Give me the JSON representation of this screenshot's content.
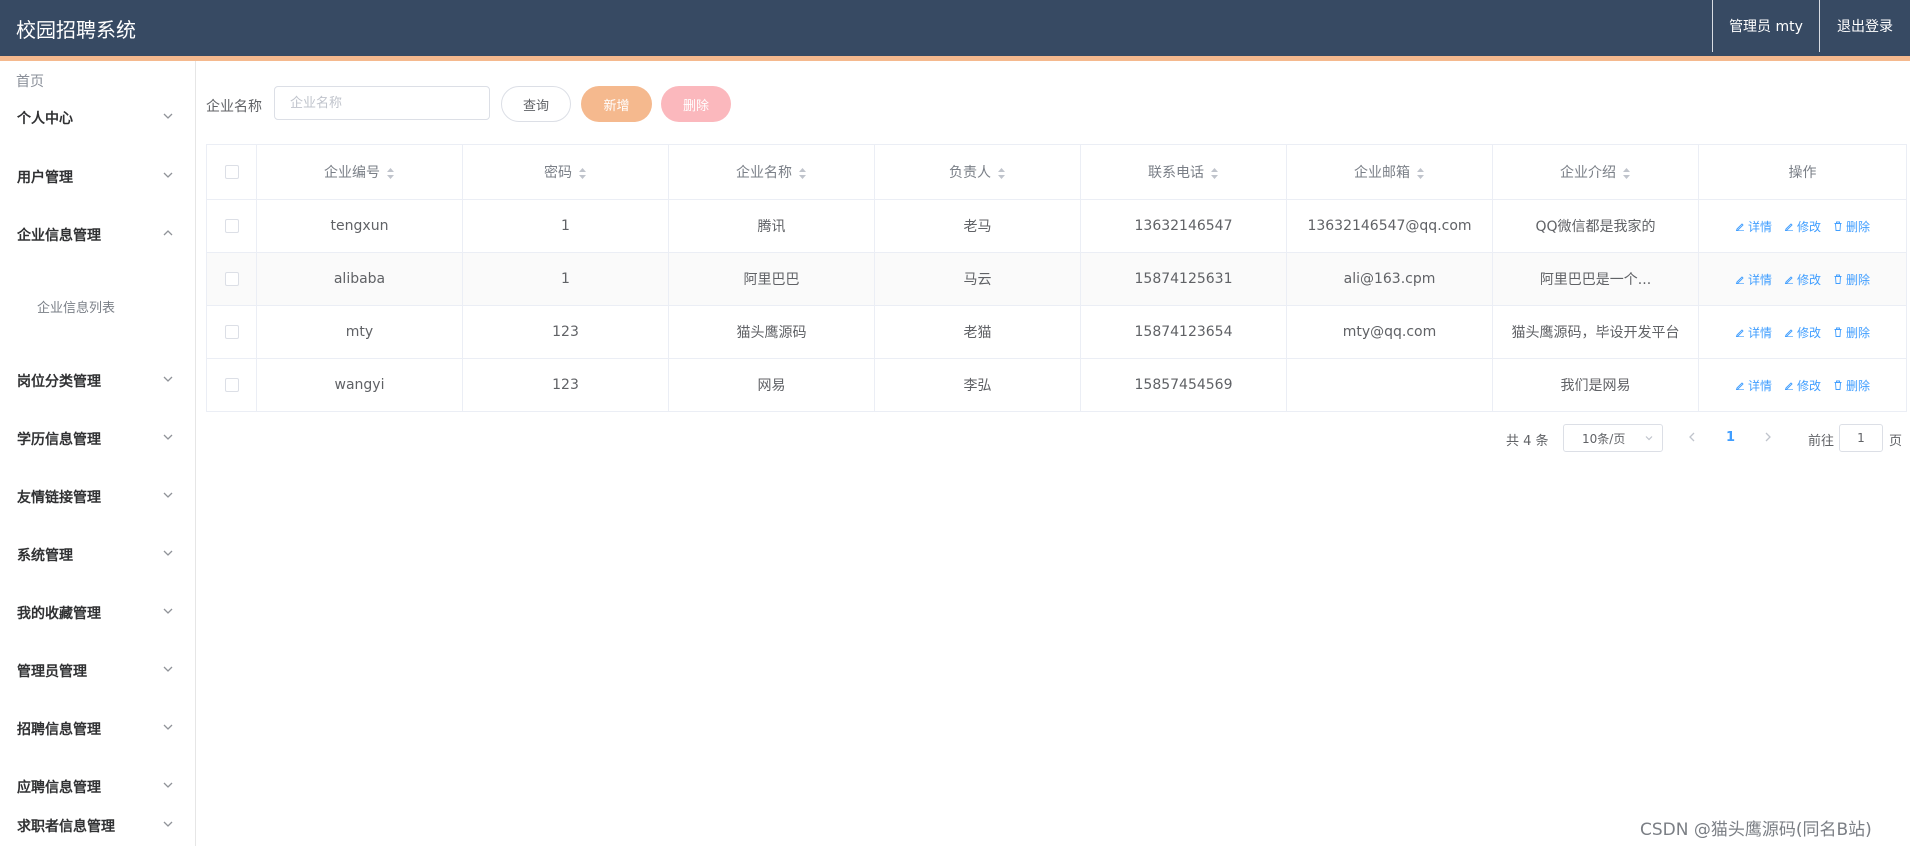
{
  "header": {
    "title": "校园招聘系统",
    "user": "管理员 mty",
    "logout": "退出登录"
  },
  "sidebar": {
    "home": "首页",
    "items": [
      {
        "label": "个人中心",
        "expanded": false
      },
      {
        "label": "用户管理",
        "expanded": false
      },
      {
        "label": "企业信息管理",
        "expanded": true,
        "sub": "企业信息列表"
      },
      {
        "label": "岗位分类管理",
        "expanded": false
      },
      {
        "label": "学历信息管理",
        "expanded": false
      },
      {
        "label": "友情链接管理",
        "expanded": false
      },
      {
        "label": "系统管理",
        "expanded": false
      },
      {
        "label": "我的收藏管理",
        "expanded": false
      },
      {
        "label": "管理员管理",
        "expanded": false
      },
      {
        "label": "招聘信息管理",
        "expanded": false
      },
      {
        "label": "应聘信息管理",
        "expanded": false
      },
      {
        "label": "求职者信息管理",
        "expanded": false
      }
    ]
  },
  "search": {
    "label": "企业名称",
    "placeholder": "企业名称",
    "query": "查询",
    "add": "新增",
    "delete": "删除"
  },
  "table": {
    "columns": [
      "企业编号",
      "密码",
      "企业名称",
      "负责人",
      "联系电话",
      "企业邮箱",
      "企业介绍",
      "操作"
    ],
    "actions": {
      "detail": "详情",
      "edit": "修改",
      "delete": "删除"
    },
    "rows": [
      [
        "tengxun",
        "1",
        "腾讯",
        "老马",
        "13632146547",
        "13632146547@qq.com",
        "QQ微信都是我家的"
      ],
      [
        "alibaba",
        "1",
        "阿里巴巴",
        "马云",
        "15874125631",
        "ali@163.cpm",
        "阿里巴巴是一个..."
      ],
      [
        "mty",
        "123",
        "猫头鹰源码",
        "老猫",
        "15874123654",
        "mty@qq.com",
        "猫头鹰源码，毕设开发平台"
      ],
      [
        "wangyi",
        "123",
        "网易",
        "李弘",
        "15857454569",
        "",
        "我们是网易"
      ]
    ]
  },
  "pagination": {
    "total": "共 4 条",
    "page_size": "10条/页",
    "current": "1",
    "goto_prefix": "前往",
    "goto_value": "1",
    "goto_suffix": "页"
  },
  "watermark": "CSDN @猫头鹰源码(同名B站)",
  "colors": {
    "header": "#374a63",
    "accent": "#f5b98e",
    "delete": "#fbb8bd",
    "link": "#409eff"
  }
}
